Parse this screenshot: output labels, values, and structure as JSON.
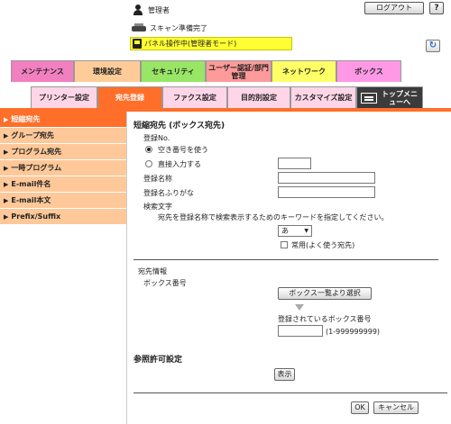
{
  "header": {
    "user_label": "管理者",
    "logout_label": "ログアウト",
    "help_label": "?",
    "status_text": "スキャン準備完了",
    "mode_text": "パネル操作中(管理者モード)"
  },
  "main_tabs": [
    {
      "label": "メンテナンス"
    },
    {
      "label": "環境設定"
    },
    {
      "label": "セキュリティ"
    },
    {
      "label": "ユーザー認証/部門管理"
    },
    {
      "label": "ネットワーク"
    },
    {
      "label": "ボックス"
    }
  ],
  "sub_tabs": [
    {
      "label": "プリンター設定"
    },
    {
      "label": "宛先登録"
    },
    {
      "label": "ファクス設定"
    },
    {
      "label": "目的別設定"
    },
    {
      "label": "カスタマイズ設定"
    },
    {
      "label": "トップメニューへ"
    }
  ],
  "sidebar": {
    "items": [
      {
        "label": "短縮宛先",
        "active": true
      },
      {
        "label": "グループ宛先",
        "active": false
      },
      {
        "label": "プログラム宛先",
        "active": false
      },
      {
        "label": "一時プログラム",
        "active": false
      },
      {
        "label": "E-mail件名",
        "active": false
      },
      {
        "label": "E-mail本文",
        "active": false
      },
      {
        "label": "Prefix/Suffix",
        "active": false
      }
    ]
  },
  "form": {
    "title": "短縮宛先 (ボックス宛先)",
    "reg_no_label": "登録No.",
    "radio_auto_label": "空き番号を使う",
    "radio_manual_label": "直接入力する",
    "reg_no_value": "",
    "name_label": "登録名称",
    "name_value": "",
    "furigana_label": "登録名ふりがな",
    "furigana_value": "",
    "search_char_label": "検索文字",
    "search_char_desc": "宛先を登録名称で検索表示するためのキーワードを指定してください。",
    "search_char_value": "あ",
    "frequent_label": "常用(よく使う宛先)",
    "dest_info_label": "宛先情報",
    "box_no_label": "ボックス番号",
    "box_select_button": "ボックス一覧より選択",
    "registered_box_label": "登録されているボックス番号",
    "box_no_value": "",
    "box_no_range": "(1-999999999)",
    "ref_perm_title": "参照許可設定",
    "display_button": "表示",
    "ok_button": "OK",
    "cancel_button": "キャンセル"
  }
}
